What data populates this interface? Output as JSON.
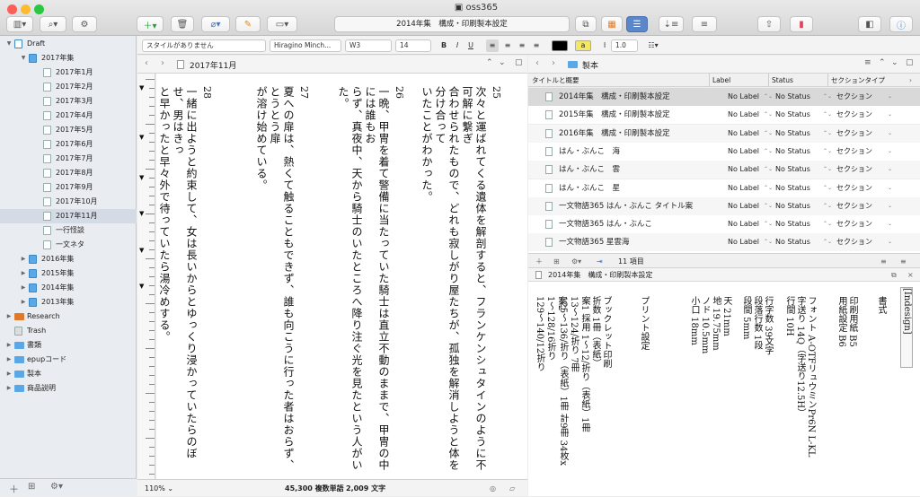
{
  "window": {
    "title": "oss365"
  },
  "toolbar": {
    "address": "2014年集　構成・印刷製本設定",
    "view_label": "+"
  },
  "format": {
    "style": "スタイルがありません",
    "font": "Hiragino Minch...",
    "weight": "W3",
    "size": "14",
    "line_spacing": "1.0",
    "bold": "B",
    "italic": "I",
    "underline": "U",
    "highlight": "a",
    "text_color": "#000000",
    "highlight_color": "#f5e663"
  },
  "binder": {
    "items": [
      {
        "label": "Draft",
        "level": 0,
        "kind": "draft",
        "disc": "▼"
      },
      {
        "label": "2017年集",
        "level": 1,
        "kind": "book",
        "disc": "▼"
      },
      {
        "label": "2017年1月",
        "level": 2,
        "kind": "doc"
      },
      {
        "label": "2017年2月",
        "level": 2,
        "kind": "doc"
      },
      {
        "label": "2017年3月",
        "level": 2,
        "kind": "doc"
      },
      {
        "label": "2017年4月",
        "level": 2,
        "kind": "doc"
      },
      {
        "label": "2017年5月",
        "level": 2,
        "kind": "doc"
      },
      {
        "label": "2017年6月",
        "level": 2,
        "kind": "doc"
      },
      {
        "label": "2017年7月",
        "level": 2,
        "kind": "doc"
      },
      {
        "label": "2017年8月",
        "level": 2,
        "kind": "doc"
      },
      {
        "label": "2017年9月",
        "level": 2,
        "kind": "doc"
      },
      {
        "label": "2017年10月",
        "level": 2,
        "kind": "doc"
      },
      {
        "label": "2017年11月",
        "level": 2,
        "kind": "doc"
      },
      {
        "label": "一行怪談",
        "level": 2,
        "kind": "doc"
      },
      {
        "label": "一文ネタ",
        "level": 2,
        "kind": "doc"
      },
      {
        "label": "2016年集",
        "level": 1,
        "kind": "book",
        "disc": "▶"
      },
      {
        "label": "2015年集",
        "level": 1,
        "kind": "book",
        "disc": "▶"
      },
      {
        "label": "2014年集",
        "level": 1,
        "kind": "book",
        "disc": "▶"
      },
      {
        "label": "2013年集",
        "level": 1,
        "kind": "book",
        "disc": "▶"
      },
      {
        "label": "Research",
        "level": 0,
        "kind": "research",
        "disc": "▶"
      },
      {
        "label": "Trash",
        "level": 0,
        "kind": "trash",
        "disc": ""
      },
      {
        "label": "書類",
        "level": 0,
        "kind": "folder",
        "disc": "▶"
      },
      {
        "label": "epupコード",
        "level": 0,
        "kind": "folder",
        "disc": "▶"
      },
      {
        "label": "製本",
        "level": 0,
        "kind": "folder",
        "disc": "▶"
      },
      {
        "label": "商品説明",
        "level": 0,
        "kind": "folder",
        "disc": "▶"
      }
    ]
  },
  "editor": {
    "doc_title": "2017年11月",
    "zoom": "110%",
    "word_count": "45,300 複数単語",
    "char_count": "2,009 文字",
    "columns": [
      {
        "num": "25",
        "text": "次々と運ばれてくる遺体を解剖すると、フランケンシュタインのように不可解に繋ぎ\n合わせられたもので、どれも寂しがり屋たちが、孤独を解消しようと体を分け合って\nいたことがわかった。"
      },
      {
        "num": "26",
        "text": "一晩、甲冑を着て警備に当たっていた騎士は直立不動のままで、甲冑の中には誰もお\nらず、真夜中、天から騎士のいたところへ降り注ぐ光を見たという人がいた。"
      },
      {
        "num": "27",
        "text": "夏への扉は、熱くて触ることもできず、誰も向こうに行った者はおらず、とうとう扉\nが溶け始めている。"
      },
      {
        "num": "28",
        "text": "一緒に出ようと約束して、女は長いからとゆっくり浸かっていたらのぼせ、男はきっ\nと早かったと早々外で待っていたら湯冷めする。"
      }
    ]
  },
  "outliner": {
    "folder": "製本",
    "columns": [
      "タイトルと概要",
      "Label",
      "Status",
      "セクションタイプ"
    ],
    "rows": [
      {
        "title": "2014年集　構成・印刷製本設定",
        "label": "No Label",
        "status": "No Status",
        "type": "セクション"
      },
      {
        "title": "2015年集　構成・印刷製本設定",
        "label": "No Label",
        "status": "No Status",
        "type": "セクション"
      },
      {
        "title": "2016年集　構成・印刷製本設定",
        "label": "No Label",
        "status": "No Status",
        "type": "セクション"
      },
      {
        "title": "はん・ぶんこ　海",
        "label": "No Label",
        "status": "No Status",
        "type": "セクション"
      },
      {
        "title": "はん・ぶんこ　雲",
        "label": "No Label",
        "status": "No Status",
        "type": "セクション"
      },
      {
        "title": "はん・ぶんこ　星",
        "label": "No Label",
        "status": "No Status",
        "type": "セクション"
      },
      {
        "title": "一文物語365 はん・ぶんこ タイトル案",
        "label": "No Label",
        "status": "No Status",
        "type": "セクション"
      },
      {
        "title": "一文物語365 はん・ぶんこ",
        "label": "No Label",
        "status": "No Status",
        "type": "セクション"
      },
      {
        "title": "一文物語365 星雲海",
        "label": "No Label",
        "status": "No Status",
        "type": "セクション"
      }
    ],
    "count": "11 項目"
  },
  "inspector": {
    "title": "2014年集　構成・印刷製本設定",
    "tag": "[Indesign]",
    "columns": [
      "書式",
      "印刷用紙 B5\n用紙設定 B6",
      "フォント A-OTFリュウミンPr6N L-KL\n字送り 14Q（字送り12.5H）\n行間 10H",
      "行字数 39文字\n段落行数 1段\n段間 5mm",
      "天 21mm\n地 19.75mm\nノド 10.5mm\n小口 18mm",
      "プリント設定",
      "ブックレット印刷\n折数 1冊（表紙）\n案1 採用 1～12/折り（表紙）1冊\n13～124/折り 7冊\n125～136/折り（表紙）1冊 計9冊 34枚x",
      "案2\n1～128/16折り\n129～140/12折り"
    ]
  }
}
